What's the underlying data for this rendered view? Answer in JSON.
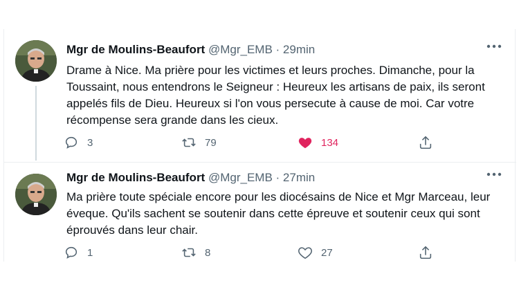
{
  "tweets": [
    {
      "author": "Mgr de Moulins-Beaufort",
      "handle": "@Mgr_EMB",
      "separator": "·",
      "time": "29min",
      "text": "Drame à Nice. Ma prière pour les victimes et leurs proches. Dimanche, pour la Toussaint, nous entendrons le Seigneur : Heureux les artisans de paix, ils seront appelés fils de Dieu. Heureux si l'on vous persecute à cause de moi. Car votre récompense sera grande dans les cieux.",
      "replies": "3",
      "retweets": "79",
      "likes": "134",
      "liked": true
    },
    {
      "author": "Mgr de Moulins-Beaufort",
      "handle": "@Mgr_EMB",
      "separator": "·",
      "time": "27min",
      "text": "Ma prière toute spéciale encore pour les diocésains de Nice et Mgr Marceau, leur éveque. Qu'ils sachent se soutenir dans cette épreuve et soutenir ceux qui sont  éprouvés dans leur chair.",
      "replies": "1",
      "retweets": "8",
      "likes": "27",
      "liked": false
    }
  ],
  "colors": {
    "like_active": "#e0245e",
    "muted": "#536471",
    "text": "#0f1419"
  },
  "icons": [
    "reply-icon",
    "retweet-icon",
    "like-icon",
    "share-icon",
    "more-icon"
  ]
}
